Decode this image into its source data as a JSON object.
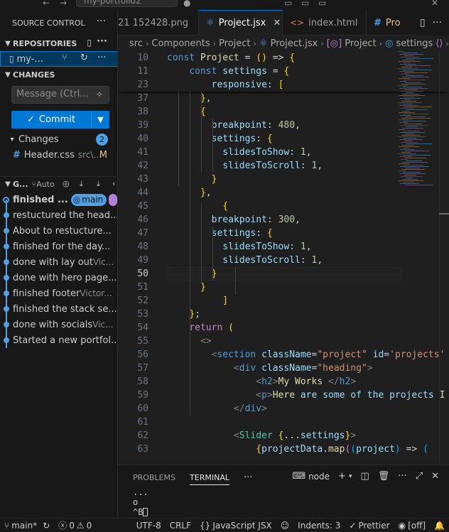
{
  "titlebar": {
    "search_text": "my-portfolio2",
    "glyphs": [
      "←",
      "→",
      "●",
      "▭",
      "▭",
      "▭",
      "✕"
    ]
  },
  "sidebar": {
    "title": "SOURCE CONTROL",
    "more": "···",
    "repositories_label": "REPOSITORIES",
    "repo_name": "my-...",
    "changes_label": "CHANGES",
    "message_placeholder": "Message (Ctrl...",
    "commit_label": "Commit",
    "changes_group_label": "Changes",
    "changes_count": "2",
    "changed_file": {
      "name": "Header.css",
      "path": "src\\...",
      "status": "M"
    },
    "graph_label": "G...",
    "graph_auto": "Auto",
    "commits": [
      {
        "message": "finished ...",
        "author": "",
        "branch": "main"
      },
      {
        "message": "restuctured the head...",
        "author": ""
      },
      {
        "message": "About to restucture...",
        "author": ""
      },
      {
        "message": "finished for  the day...",
        "author": ""
      },
      {
        "message": "done with lay out ",
        "author": "Vic..."
      },
      {
        "message": "done with hero page...",
        "author": ""
      },
      {
        "message": "finished footer ",
        "author": "Victor..."
      },
      {
        "message": "finished the stack se...",
        "author": ""
      },
      {
        "message": "done with socials ",
        "author": "Vic..."
      },
      {
        "message": "Started a new portfol...",
        "author": ""
      }
    ]
  },
  "tabs": [
    {
      "label": "21 152428.png",
      "icon": "",
      "active": false
    },
    {
      "label": "Project.jsx",
      "icon": "⚛",
      "active": true
    },
    {
      "label": "index.html",
      "icon": "<>",
      "active": false
    },
    {
      "label": "Pro",
      "icon": "#",
      "active": false
    }
  ],
  "breadcrumb": [
    "src",
    "Components",
    "Project",
    "Project.jsx",
    "Project",
    "settings"
  ],
  "code": {
    "sticky": [
      {
        "n": "10",
        "text": "const Project = () => {"
      },
      {
        "n": "11",
        "text": "    const settings = {"
      },
      {
        "n": "23",
        "text": "        responsive: ["
      }
    ],
    "lines": [
      {
        "n": "37",
        "text": "      },"
      },
      {
        "n": "38",
        "text": "      {"
      },
      {
        "n": "39",
        "text": "        breakpoint: 480,"
      },
      {
        "n": "40",
        "text": "        settings: {"
      },
      {
        "n": "41",
        "text": "          slidesToShow: 1,"
      },
      {
        "n": "42",
        "text": "          slidesToScroll: 1,"
      },
      {
        "n": "43",
        "text": "        }"
      },
      {
        "n": "44",
        "text": "      },"
      },
      {
        "n": "45",
        "text": "          {"
      },
      {
        "n": "46",
        "text": "        breakpoint: 300,"
      },
      {
        "n": "47",
        "text": "        settings: {"
      },
      {
        "n": "48",
        "text": "          slidesToShow: 1,"
      },
      {
        "n": "49",
        "text": "          slidesToScroll: 1,"
      },
      {
        "n": "50",
        "text": "        }"
      },
      {
        "n": "51",
        "text": "      }"
      },
      {
        "n": "52",
        "text": "          ]"
      },
      {
        "n": "53",
        "text": "    };"
      },
      {
        "n": "54",
        "text": "    return ("
      },
      {
        "n": "55",
        "text": "      <>"
      },
      {
        "n": "56",
        "text": "        <section className=\"project\" id='projects'"
      },
      {
        "n": "57",
        "text": "            <div className=\"heading\">"
      },
      {
        "n": "58",
        "text": "                <h2>My Works </h2>"
      },
      {
        "n": "59",
        "text": "                <p>Here are some of the projects I"
      },
      {
        "n": "60",
        "text": "            </div>"
      },
      {
        "n": "61",
        "text": ""
      },
      {
        "n": "62",
        "text": "            <Slider {...settings}>"
      },
      {
        "n": "63",
        "text": "                {projectData.map((project) => ("
      }
    ]
  },
  "panel": {
    "tabs": [
      "PROBLEMS",
      "TERMINAL"
    ],
    "active_tab": "TERMINAL",
    "more": "···",
    "terminal_name": "node",
    "terminal_lines": [
      "...",
      "o",
      "^B"
    ]
  },
  "statusbar": {
    "branch": "main*",
    "errors": "0",
    "warnings": "0",
    "encoding": "UTF-8",
    "eol": "CRLF",
    "language": "JavaScript JSX",
    "indent": "Indents: 3",
    "formatter": "Prettier",
    "live": "[off]"
  },
  "colors": {
    "accent": "#0078d4",
    "badge": "#4d9fe6",
    "graph_purple": "#b180d7"
  }
}
